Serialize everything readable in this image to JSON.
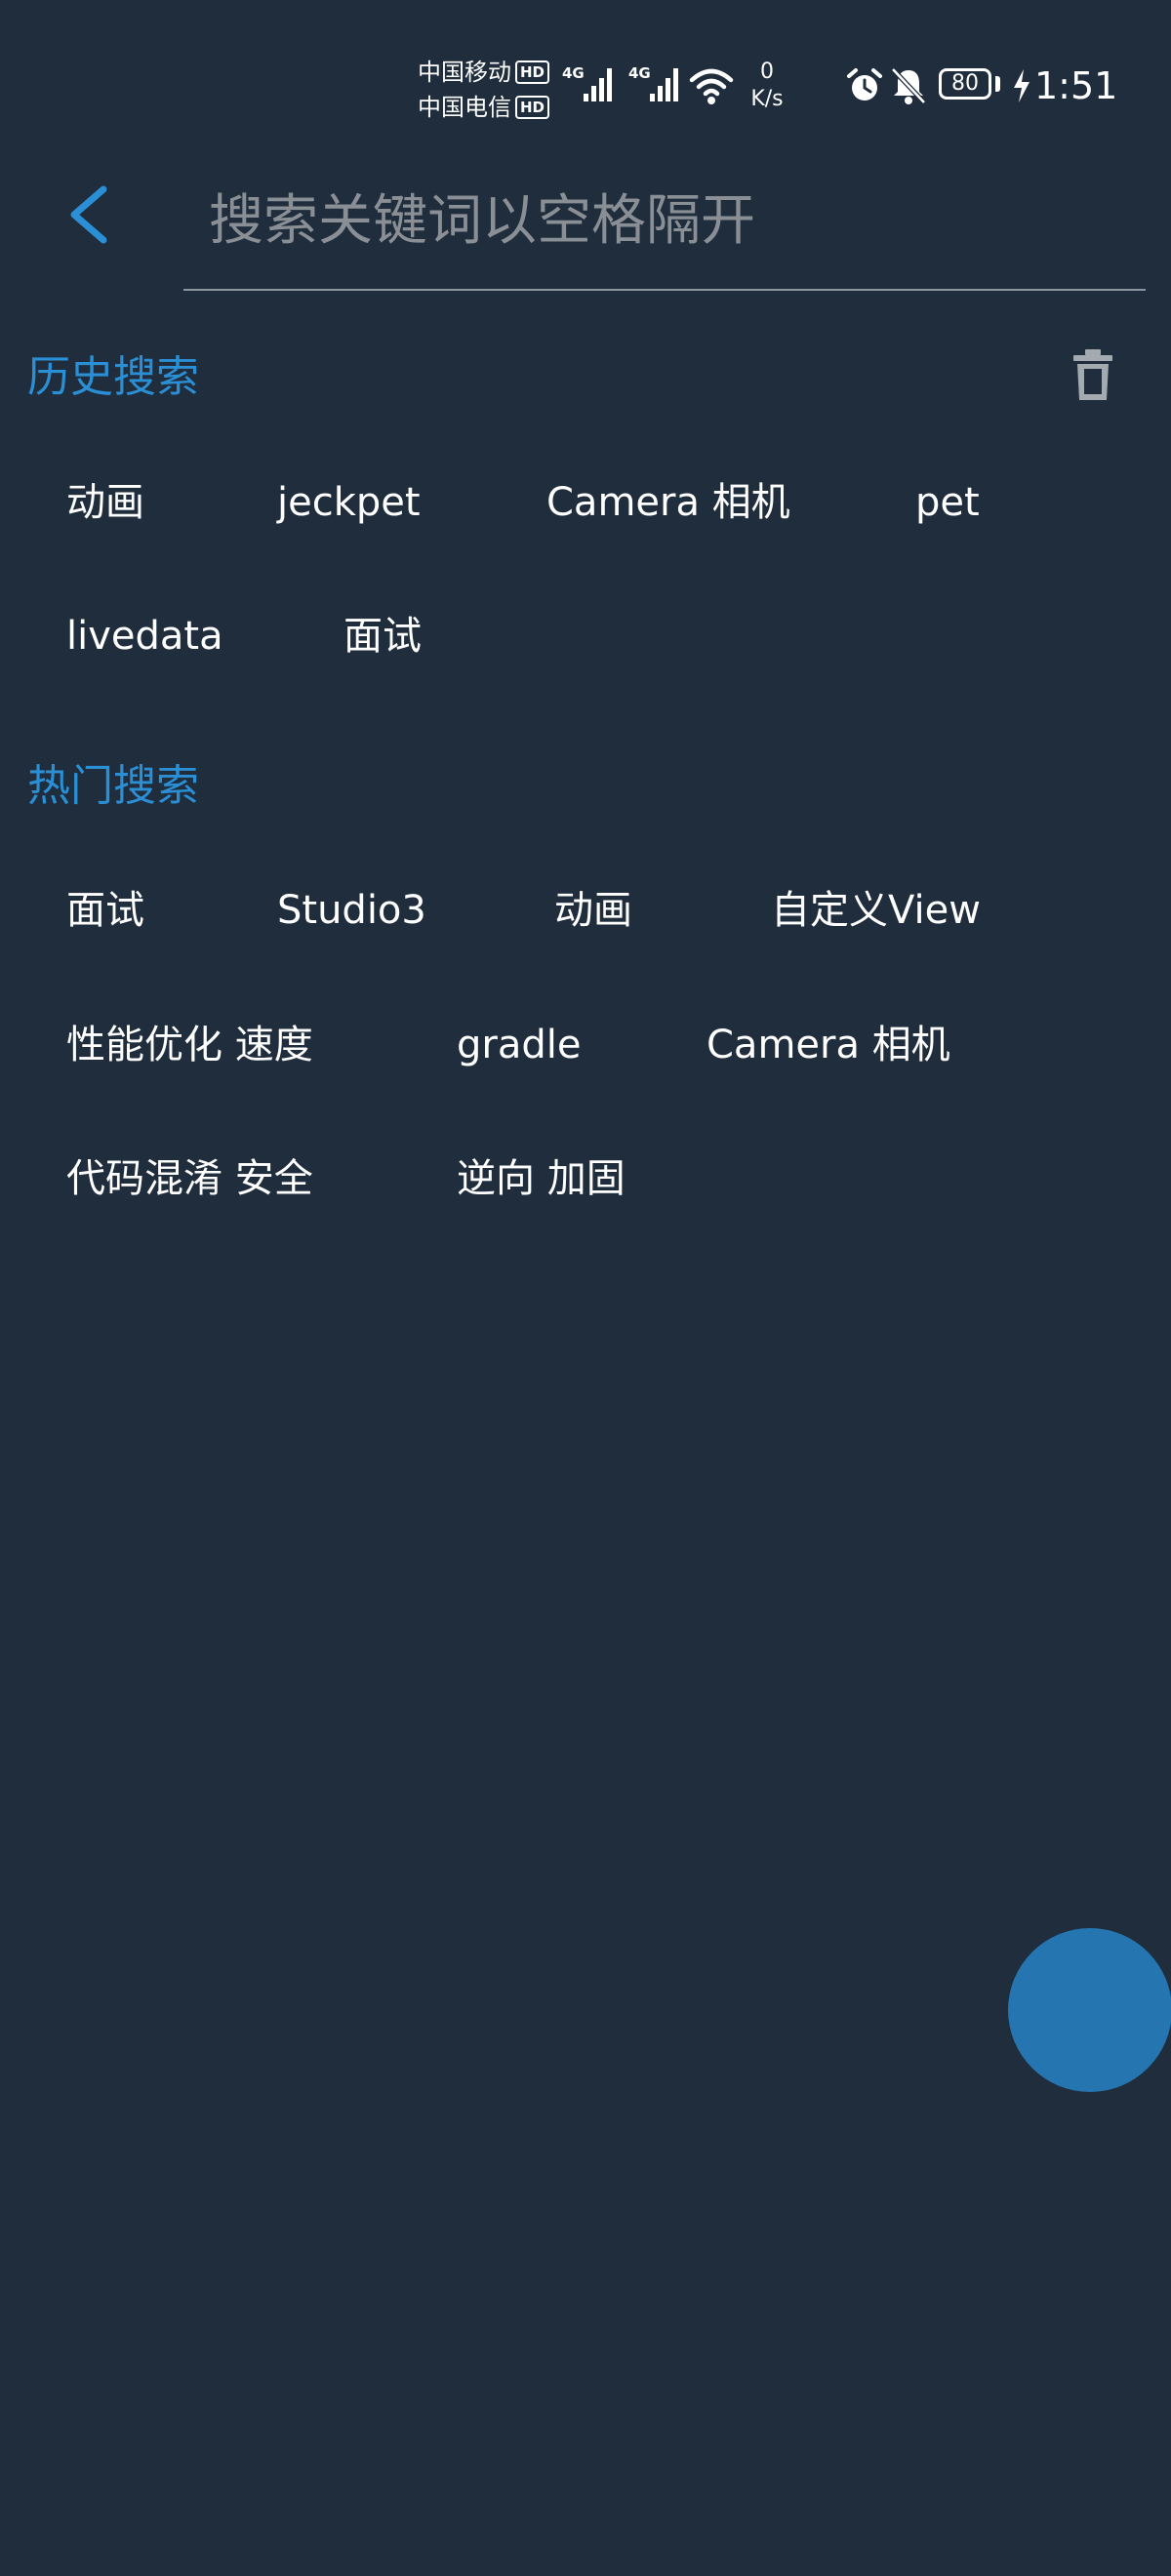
{
  "status_bar": {
    "carrier_1": "中国移动",
    "carrier_2": "中国电信",
    "hd_label": "HD",
    "network_1": "4G",
    "network_2": "4G",
    "net_speed_value": "0",
    "net_speed_unit": "K/s",
    "battery_level": "80",
    "time": "1:51"
  },
  "search": {
    "placeholder": "搜索关键词以空格隔开",
    "value": ""
  },
  "history": {
    "title": "历史搜索",
    "tags": [
      "动画",
      "jeckpet",
      "Camera 相机",
      "pet",
      "livedata",
      "面试"
    ]
  },
  "hot": {
    "title": "热门搜索",
    "tags": [
      "面试",
      "Studio3",
      "动画",
      "自定义View",
      "性能优化 速度",
      "gradle",
      "Camera 相机",
      "代码混淆 安全",
      "逆向 加固"
    ]
  },
  "colors": {
    "background": "#1f2d3d",
    "accent": "#2b8fd6",
    "fab": "#2575b0",
    "tag_text": "#ffffff",
    "placeholder": "#8a8f95"
  },
  "icons": {
    "back": "chevron-left-icon",
    "clear_history": "trash-icon",
    "alarm": "alarm-icon",
    "mute": "bell-off-icon",
    "wifi": "wifi-icon",
    "charging": "bolt-icon"
  }
}
